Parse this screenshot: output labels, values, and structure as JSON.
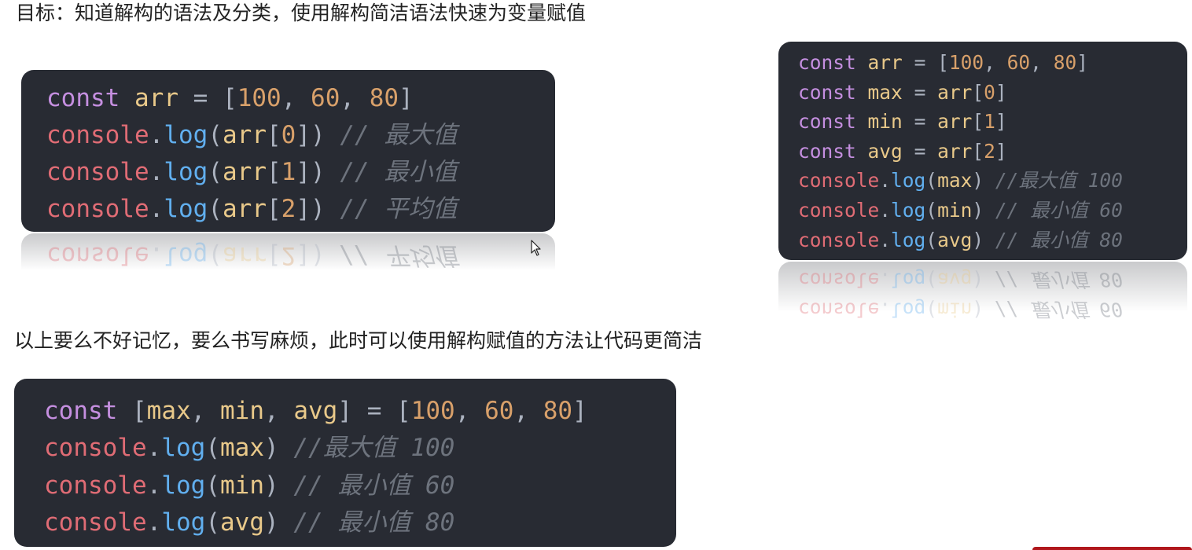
{
  "heading_goal": "目标：知道解构的语法及分类，使用解构简洁语法快速为变量赋值",
  "heading_note": "以上要么不好记忆，要么书写麻烦，此时可以使用解构赋值的方法让代码更简洁",
  "code_example_1": {
    "lines": [
      [
        [
          "kw",
          "const"
        ],
        [
          "sp",
          " "
        ],
        [
          "var",
          "arr"
        ],
        [
          "sp",
          " "
        ],
        [
          "punc",
          "="
        ],
        [
          "sp",
          " "
        ],
        [
          "punc",
          "["
        ],
        [
          "num",
          "100"
        ],
        [
          "punc",
          ","
        ],
        [
          "sp",
          " "
        ],
        [
          "num",
          "60"
        ],
        [
          "punc",
          ","
        ],
        [
          "sp",
          " "
        ],
        [
          "num",
          "80"
        ],
        [
          "punc",
          "]"
        ]
      ],
      [
        [
          "fn",
          "console"
        ],
        [
          "punc",
          "."
        ],
        [
          "meth",
          "log"
        ],
        [
          "punc",
          "("
        ],
        [
          "var",
          "arr"
        ],
        [
          "punc",
          "["
        ],
        [
          "num",
          "0"
        ],
        [
          "punc",
          "])"
        ],
        [
          "sp",
          " "
        ],
        [
          "cmt",
          "// 最大值"
        ]
      ],
      [
        [
          "fn",
          "console"
        ],
        [
          "punc",
          "."
        ],
        [
          "meth",
          "log"
        ],
        [
          "punc",
          "("
        ],
        [
          "var",
          "arr"
        ],
        [
          "punc",
          "["
        ],
        [
          "num",
          "1"
        ],
        [
          "punc",
          "])"
        ],
        [
          "sp",
          " "
        ],
        [
          "cmt",
          "// 最小值"
        ]
      ],
      [
        [
          "fn",
          "console"
        ],
        [
          "punc",
          "."
        ],
        [
          "meth",
          "log"
        ],
        [
          "punc",
          "("
        ],
        [
          "var",
          "arr"
        ],
        [
          "punc",
          "["
        ],
        [
          "num",
          "2"
        ],
        [
          "punc",
          "])"
        ],
        [
          "sp",
          " "
        ],
        [
          "cmt",
          "// 平均值"
        ]
      ]
    ]
  },
  "code_example_2": {
    "lines": [
      [
        [
          "kw",
          "const"
        ],
        [
          "sp",
          " "
        ],
        [
          "var",
          "arr"
        ],
        [
          "sp",
          " "
        ],
        [
          "punc",
          "="
        ],
        [
          "sp",
          " "
        ],
        [
          "punc",
          "["
        ],
        [
          "num",
          "100"
        ],
        [
          "punc",
          ","
        ],
        [
          "sp",
          " "
        ],
        [
          "num",
          "60"
        ],
        [
          "punc",
          ","
        ],
        [
          "sp",
          " "
        ],
        [
          "num",
          "80"
        ],
        [
          "punc",
          "]"
        ]
      ],
      [
        [
          "kw",
          "const"
        ],
        [
          "sp",
          " "
        ],
        [
          "var",
          "max"
        ],
        [
          "sp",
          " "
        ],
        [
          "punc",
          "="
        ],
        [
          "sp",
          " "
        ],
        [
          "var",
          "arr"
        ],
        [
          "punc",
          "["
        ],
        [
          "num",
          "0"
        ],
        [
          "punc",
          "]"
        ]
      ],
      [
        [
          "kw",
          "const"
        ],
        [
          "sp",
          " "
        ],
        [
          "var",
          "min"
        ],
        [
          "sp",
          " "
        ],
        [
          "punc",
          "="
        ],
        [
          "sp",
          " "
        ],
        [
          "var",
          "arr"
        ],
        [
          "punc",
          "["
        ],
        [
          "num",
          "1"
        ],
        [
          "punc",
          "]"
        ]
      ],
      [
        [
          "kw",
          "const"
        ],
        [
          "sp",
          " "
        ],
        [
          "var",
          "avg"
        ],
        [
          "sp",
          " "
        ],
        [
          "punc",
          "="
        ],
        [
          "sp",
          " "
        ],
        [
          "var",
          "arr"
        ],
        [
          "punc",
          "["
        ],
        [
          "num",
          "2"
        ],
        [
          "punc",
          "]"
        ]
      ],
      [
        [
          "fn",
          "console"
        ],
        [
          "punc",
          "."
        ],
        [
          "meth",
          "log"
        ],
        [
          "punc",
          "("
        ],
        [
          "var",
          "max"
        ],
        [
          "punc",
          ")"
        ],
        [
          "sp",
          " "
        ],
        [
          "cmt",
          "//最大值 100"
        ]
      ],
      [
        [
          "fn",
          "console"
        ],
        [
          "punc",
          "."
        ],
        [
          "meth",
          "log"
        ],
        [
          "punc",
          "("
        ],
        [
          "var",
          "min"
        ],
        [
          "punc",
          ")"
        ],
        [
          "sp",
          " "
        ],
        [
          "cmt",
          "// 最小值 60"
        ]
      ],
      [
        [
          "fn",
          "console"
        ],
        [
          "punc",
          "."
        ],
        [
          "meth",
          "log"
        ],
        [
          "punc",
          "("
        ],
        [
          "var",
          "avg"
        ],
        [
          "punc",
          ")"
        ],
        [
          "sp",
          " "
        ],
        [
          "cmt",
          "// 最小值 80"
        ]
      ]
    ]
  },
  "code_example_3": {
    "lines": [
      [
        [
          "kw",
          "const"
        ],
        [
          "sp",
          " "
        ],
        [
          "punc",
          "["
        ],
        [
          "var",
          "max"
        ],
        [
          "punc",
          ","
        ],
        [
          "sp",
          " "
        ],
        [
          "var",
          "min"
        ],
        [
          "punc",
          ","
        ],
        [
          "sp",
          " "
        ],
        [
          "var",
          "avg"
        ],
        [
          "punc",
          "]"
        ],
        [
          "sp",
          " "
        ],
        [
          "punc",
          "="
        ],
        [
          "sp",
          " "
        ],
        [
          "punc",
          "["
        ],
        [
          "num",
          "100"
        ],
        [
          "punc",
          ","
        ],
        [
          "sp",
          " "
        ],
        [
          "num",
          "60"
        ],
        [
          "punc",
          ","
        ],
        [
          "sp",
          " "
        ],
        [
          "num",
          "80"
        ],
        [
          "punc",
          "]"
        ]
      ],
      [
        [
          "fn",
          "console"
        ],
        [
          "punc",
          "."
        ],
        [
          "meth",
          "log"
        ],
        [
          "punc",
          "("
        ],
        [
          "var",
          "max"
        ],
        [
          "punc",
          ")"
        ],
        [
          "sp",
          " "
        ],
        [
          "cmt",
          "//最大值 100"
        ]
      ],
      [
        [
          "fn",
          "console"
        ],
        [
          "punc",
          "."
        ],
        [
          "meth",
          "log"
        ],
        [
          "punc",
          "("
        ],
        [
          "var",
          "min"
        ],
        [
          "punc",
          ")"
        ],
        [
          "sp",
          " "
        ],
        [
          "cmt",
          "// 最小值 60"
        ]
      ],
      [
        [
          "fn",
          "console"
        ],
        [
          "punc",
          "."
        ],
        [
          "meth",
          "log"
        ],
        [
          "punc",
          "("
        ],
        [
          "var",
          "avg"
        ],
        [
          "punc",
          ")"
        ],
        [
          "sp",
          " "
        ],
        [
          "cmt",
          "// 最小值 80"
        ]
      ]
    ]
  },
  "colors": {
    "keyword": "#c58fe0",
    "variable": "#e9c98a",
    "function": "#e06c75",
    "method": "#61afef",
    "number": "#d8a06a",
    "punctuation": "#abb2bf",
    "comment": "#6d737d",
    "code_background": "#282b33"
  },
  "icons": {
    "cursor": "mouse-pointer-icon"
  }
}
